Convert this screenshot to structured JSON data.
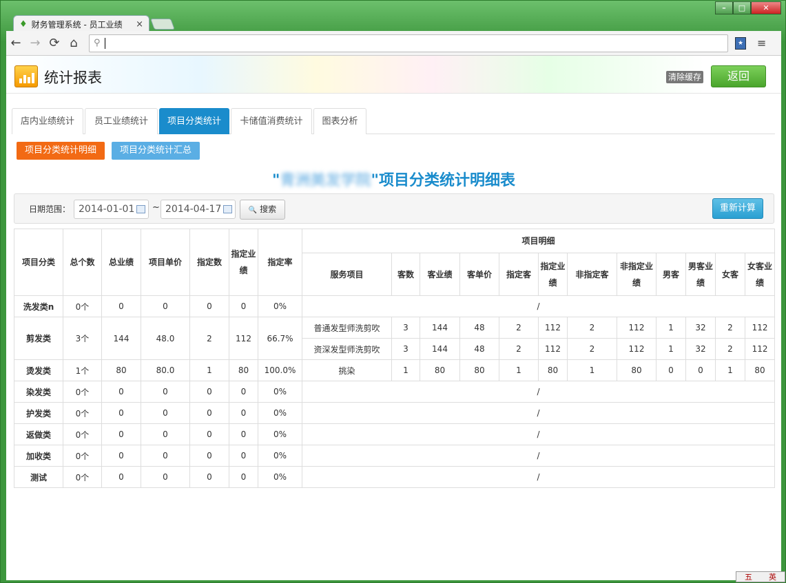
{
  "browser": {
    "tab_title": "财务管理系统 - 员工业绩",
    "tab_close": "×",
    "favicon_glyph": "♦",
    "back_glyph": "←",
    "forward_glyph": "→",
    "reload_glyph": "⟳",
    "home_glyph": "⌂",
    "search_glyph": "⚲",
    "menu_glyph": "≡",
    "address_value": ""
  },
  "header": {
    "title": "统计报表",
    "clear_cache": "清除缓存",
    "back": "返回"
  },
  "tabs": [
    "店内业绩统计",
    "员工业绩统计",
    "项目分类统计",
    "卡储值消费统计",
    "图表分析"
  ],
  "active_tab": 2,
  "subtabs": [
    "项目分类统计明细",
    "项目分类统计汇总"
  ],
  "report": {
    "title_prefix": "\"",
    "store_name": "青洲美发学院",
    "title_suffix": "\"项目分类统计明细表"
  },
  "filter": {
    "label": "日期范围：",
    "start_date": "2014-01-01",
    "end_date": "2014-04-17",
    "separator": "~",
    "search": "搜索",
    "search_icon": "🔍",
    "recalculate": "重新计算"
  },
  "table": {
    "headers": [
      "项目分类",
      "总个数",
      "总业绩",
      "项目单价",
      "指定数",
      "指定业绩",
      "指定率"
    ],
    "detail_header": "项目明细",
    "detail_headers": [
      "服务项目",
      "客数",
      "客业绩",
      "客单价",
      "指定客",
      "指定业绩",
      "非指定客",
      "非指定业绩",
      "男客",
      "男客业绩",
      "女客",
      "女客业绩"
    ],
    "empty_mark": "/",
    "rows": [
      {
        "cat": "洗发类n",
        "count": "0个",
        "total": "0",
        "price": "0",
        "designated": "0",
        "designated_perf": "0",
        "rate": "0%",
        "details": []
      },
      {
        "cat": "剪发类",
        "count": "3个",
        "total": "144",
        "price": "48.0",
        "designated": "2",
        "designated_perf": "112",
        "rate": "66.7%",
        "details": [
          [
            "普通发型师洗剪吹",
            "3",
            "144",
            "48",
            "2",
            "112",
            "2",
            "112",
            "1",
            "32",
            "2",
            "112"
          ],
          [
            "资深发型师洗剪吹",
            "3",
            "144",
            "48",
            "2",
            "112",
            "2",
            "112",
            "1",
            "32",
            "2",
            "112"
          ]
        ]
      },
      {
        "cat": "烫发类",
        "count": "1个",
        "total": "80",
        "price": "80.0",
        "designated": "1",
        "designated_perf": "80",
        "rate": "100.0%",
        "details": [
          [
            "挑染",
            "1",
            "80",
            "80",
            "1",
            "80",
            "1",
            "80",
            "0",
            "0",
            "1",
            "80"
          ]
        ]
      },
      {
        "cat": "染发类",
        "count": "0个",
        "total": "0",
        "price": "0",
        "designated": "0",
        "designated_perf": "0",
        "rate": "0%",
        "details": []
      },
      {
        "cat": "护发类",
        "count": "0个",
        "total": "0",
        "price": "0",
        "designated": "0",
        "designated_perf": "0",
        "rate": "0%",
        "details": []
      },
      {
        "cat": "返做类",
        "count": "0个",
        "total": "0",
        "price": "0",
        "designated": "0",
        "designated_perf": "0",
        "rate": "0%",
        "details": []
      },
      {
        "cat": "加收类",
        "count": "0个",
        "total": "0",
        "price": "0",
        "designated": "0",
        "designated_perf": "0",
        "rate": "0%",
        "details": []
      },
      {
        "cat": "测试",
        "count": "0个",
        "total": "0",
        "price": "0",
        "designated": "0",
        "designated_perf": "0",
        "rate": "0%",
        "details": []
      }
    ]
  },
  "ime": [
    "五",
    "英"
  ],
  "colors": {
    "accent": "#1a8ccc",
    "orange": "#f26a14",
    "green": "#4aa52c"
  }
}
